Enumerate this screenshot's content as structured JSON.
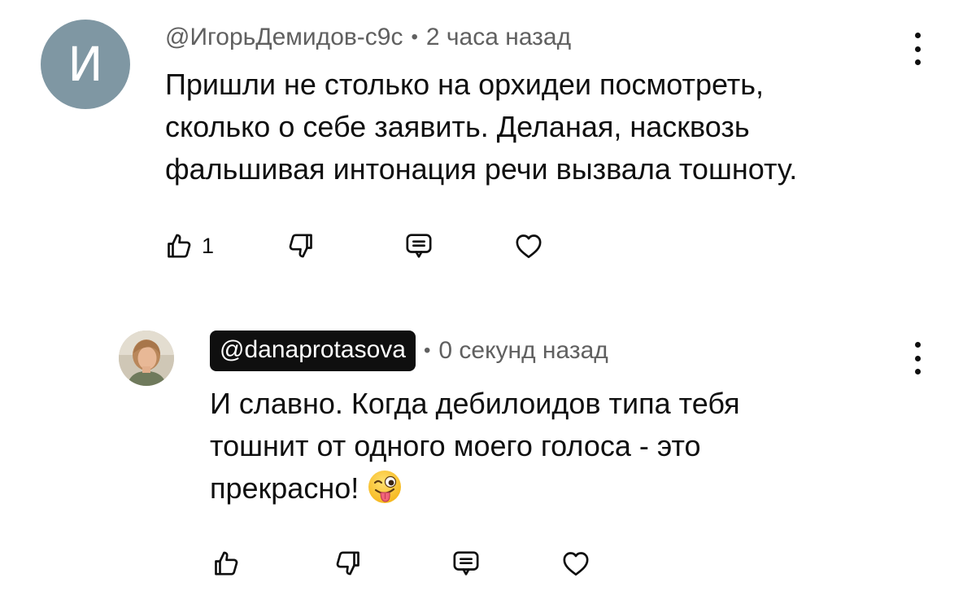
{
  "comments": [
    {
      "avatar_letter": "И",
      "avatar_color": "#7f97a3",
      "author": "@ИгорьДемидов-с9с",
      "separator": "•",
      "time": "2 часа назад",
      "text_lines": [
        "Пришли не столько на орхидеи посмотреть,",
        "сколько о себе заявить. Деланая, насквозь",
        "фальшивая интонация речи вызвала тошноту."
      ],
      "like_count": "1",
      "icons": [
        "thumb-up-icon",
        "thumb-down-icon",
        "reply-icon",
        "heart-icon",
        "more-vert-icon"
      ]
    },
    {
      "avatar": "user-photo-avatar",
      "author": "@danaprotasova",
      "author_highlighted": true,
      "separator": "•",
      "time": "0 секунд назад",
      "text_lines": [
        "И славно. Когда дебилоидов типа тебя",
        "тошнит от одного моего голоса - это",
        "прекрасно!"
      ],
      "emoji": "winking-face-with-tongue-emoji",
      "like_count": "",
      "icons": [
        "thumb-up-icon",
        "thumb-down-icon",
        "reply-icon",
        "heart-icon",
        "more-vert-icon"
      ]
    }
  ]
}
